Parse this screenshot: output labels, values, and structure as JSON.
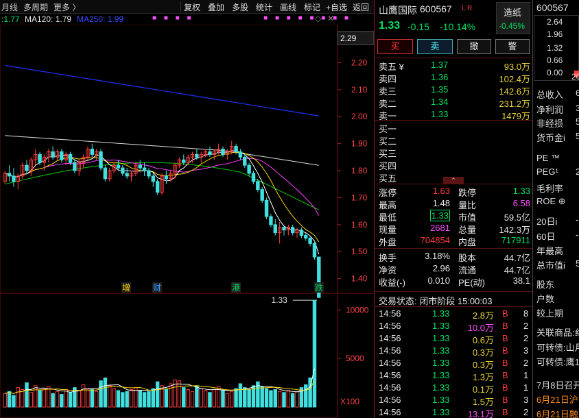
{
  "toolbar": {
    "left": [
      "月线",
      "多周期",
      "更多 〉"
    ],
    "right": [
      "复权",
      "叠加",
      "多股",
      "统计",
      "画线",
      "标记",
      "+自选",
      "返回"
    ]
  },
  "legend": {
    "ma60": ":1.77",
    "ma120": "MA120: 1.79",
    "ma250": "MA250: 1.99",
    "top_price": "2.29"
  },
  "chart_data": {
    "type": "candlestick",
    "price_ticks": [
      "2.20",
      "2.10",
      "2.00",
      "1.90",
      "1.80",
      "1.70",
      "1.60",
      "1.50",
      "1.40"
    ],
    "volume_ticks": [
      "10000",
      "5000"
    ],
    "volume_unit": "X100",
    "low_label": "1.33",
    "markers": [
      {
        "text": "增",
        "color": "#ffd700"
      },
      {
        "text": "财",
        "color": "#3399ff"
      },
      {
        "text": "港",
        "color": "#00e060"
      },
      {
        "text": "跌",
        "color": "#00e060"
      }
    ],
    "colors": {
      "up": "#ff3b3b",
      "down": "#40e0e0",
      "ma5": "#ffffff",
      "ma10": "#ffd700",
      "ma20": "#ff40ff",
      "ma60": "#00cc00",
      "ma120": "#dddddd",
      "ma250": "#2030ff"
    },
    "candles": [
      {
        "o": 1.76,
        "h": 1.8,
        "l": 1.75,
        "c": 1.79
      },
      {
        "o": 1.79,
        "h": 1.82,
        "l": 1.76,
        "c": 1.78
      },
      {
        "o": 1.78,
        "h": 1.81,
        "l": 1.74,
        "c": 1.76
      },
      {
        "o": 1.76,
        "h": 1.79,
        "l": 1.73,
        "c": 1.78
      },
      {
        "o": 1.78,
        "h": 1.83,
        "l": 1.77,
        "c": 1.82
      },
      {
        "o": 1.82,
        "h": 1.84,
        "l": 1.79,
        "c": 1.8
      },
      {
        "o": 1.8,
        "h": 1.85,
        "l": 1.78,
        "c": 1.84
      },
      {
        "o": 1.84,
        "h": 1.88,
        "l": 1.82,
        "c": 1.86
      },
      {
        "o": 1.86,
        "h": 1.87,
        "l": 1.82,
        "c": 1.83
      },
      {
        "o": 1.83,
        "h": 1.86,
        "l": 1.8,
        "c": 1.85
      },
      {
        "o": 1.85,
        "h": 1.88,
        "l": 1.83,
        "c": 1.87
      },
      {
        "o": 1.87,
        "h": 1.89,
        "l": 1.84,
        "c": 1.85
      },
      {
        "o": 1.85,
        "h": 1.88,
        "l": 1.84,
        "c": 1.87
      },
      {
        "o": 1.87,
        "h": 1.88,
        "l": 1.83,
        "c": 1.84
      },
      {
        "o": 1.84,
        "h": 1.87,
        "l": 1.82,
        "c": 1.86
      },
      {
        "o": 1.86,
        "h": 1.87,
        "l": 1.82,
        "c": 1.83
      },
      {
        "o": 1.83,
        "h": 1.84,
        "l": 1.79,
        "c": 1.8
      },
      {
        "o": 1.8,
        "h": 1.84,
        "l": 1.78,
        "c": 1.83
      },
      {
        "o": 1.83,
        "h": 1.86,
        "l": 1.81,
        "c": 1.85
      },
      {
        "o": 1.85,
        "h": 1.89,
        "l": 1.84,
        "c": 1.88
      },
      {
        "o": 1.88,
        "h": 1.9,
        "l": 1.85,
        "c": 1.86
      },
      {
        "o": 1.86,
        "h": 1.88,
        "l": 1.84,
        "c": 1.87
      },
      {
        "o": 1.87,
        "h": 1.88,
        "l": 1.8,
        "c": 1.81
      },
      {
        "o": 1.81,
        "h": 1.82,
        "l": 1.76,
        "c": 1.77
      },
      {
        "o": 1.77,
        "h": 1.81,
        "l": 1.76,
        "c": 1.8
      },
      {
        "o": 1.8,
        "h": 1.83,
        "l": 1.79,
        "c": 1.82
      },
      {
        "o": 1.82,
        "h": 1.84,
        "l": 1.8,
        "c": 1.81
      },
      {
        "o": 1.81,
        "h": 1.82,
        "l": 1.78,
        "c": 1.79
      },
      {
        "o": 1.79,
        "h": 1.81,
        "l": 1.77,
        "c": 1.78
      },
      {
        "o": 1.78,
        "h": 1.8,
        "l": 1.76,
        "c": 1.79
      },
      {
        "o": 1.79,
        "h": 1.83,
        "l": 1.78,
        "c": 1.82
      },
      {
        "o": 1.82,
        "h": 1.84,
        "l": 1.8,
        "c": 1.81
      },
      {
        "o": 1.81,
        "h": 1.83,
        "l": 1.78,
        "c": 1.8
      },
      {
        "o": 1.8,
        "h": 1.81,
        "l": 1.77,
        "c": 1.78
      },
      {
        "o": 1.78,
        "h": 1.79,
        "l": 1.74,
        "c": 1.76
      },
      {
        "o": 1.76,
        "h": 1.77,
        "l": 1.71,
        "c": 1.72
      },
      {
        "o": 1.72,
        "h": 1.79,
        "l": 1.71,
        "c": 1.78
      },
      {
        "o": 1.78,
        "h": 1.8,
        "l": 1.75,
        "c": 1.77
      },
      {
        "o": 1.77,
        "h": 1.8,
        "l": 1.76,
        "c": 1.79
      },
      {
        "o": 1.79,
        "h": 1.83,
        "l": 1.77,
        "c": 1.82
      },
      {
        "o": 1.82,
        "h": 1.85,
        "l": 1.81,
        "c": 1.84
      },
      {
        "o": 1.84,
        "h": 1.86,
        "l": 1.82,
        "c": 1.83
      },
      {
        "o": 1.83,
        "h": 1.86,
        "l": 1.82,
        "c": 1.85
      },
      {
        "o": 1.85,
        "h": 1.87,
        "l": 1.83,
        "c": 1.86
      },
      {
        "o": 1.86,
        "h": 1.88,
        "l": 1.84,
        "c": 1.85
      },
      {
        "o": 1.85,
        "h": 1.87,
        "l": 1.83,
        "c": 1.86
      },
      {
        "o": 1.86,
        "h": 1.88,
        "l": 1.85,
        "c": 1.87
      },
      {
        "o": 1.87,
        "h": 1.89,
        "l": 1.85,
        "c": 1.86
      },
      {
        "o": 1.86,
        "h": 1.88,
        "l": 1.84,
        "c": 1.87
      },
      {
        "o": 1.87,
        "h": 1.9,
        "l": 1.86,
        "c": 1.88
      },
      {
        "o": 1.88,
        "h": 1.89,
        "l": 1.85,
        "c": 1.86
      },
      {
        "o": 1.86,
        "h": 1.88,
        "l": 1.84,
        "c": 1.87
      },
      {
        "o": 1.87,
        "h": 1.91,
        "l": 1.86,
        "c": 1.89
      },
      {
        "o": 1.89,
        "h": 1.9,
        "l": 1.86,
        "c": 1.87
      },
      {
        "o": 1.87,
        "h": 1.88,
        "l": 1.84,
        "c": 1.85
      },
      {
        "o": 1.85,
        "h": 1.86,
        "l": 1.81,
        "c": 1.82
      },
      {
        "o": 1.82,
        "h": 1.83,
        "l": 1.78,
        "c": 1.79
      },
      {
        "o": 1.79,
        "h": 1.8,
        "l": 1.75,
        "c": 1.76
      },
      {
        "o": 1.76,
        "h": 1.77,
        "l": 1.72,
        "c": 1.73
      },
      {
        "o": 1.73,
        "h": 1.74,
        "l": 1.68,
        "c": 1.69
      },
      {
        "o": 1.69,
        "h": 1.7,
        "l": 1.62,
        "c": 1.63
      },
      {
        "o": 1.63,
        "h": 1.64,
        "l": 1.59,
        "c": 1.6
      },
      {
        "o": 1.6,
        "h": 1.62,
        "l": 1.56,
        "c": 1.57
      },
      {
        "o": 1.57,
        "h": 1.61,
        "l": 1.53,
        "c": 1.59
      },
      {
        "o": 1.59,
        "h": 1.6,
        "l": 1.56,
        "c": 1.58
      },
      {
        "o": 1.58,
        "h": 1.6,
        "l": 1.56,
        "c": 1.59
      },
      {
        "o": 1.59,
        "h": 1.6,
        "l": 1.56,
        "c": 1.57
      },
      {
        "o": 1.57,
        "h": 1.59,
        "l": 1.55,
        "c": 1.58
      },
      {
        "o": 1.58,
        "h": 1.59,
        "l": 1.55,
        "c": 1.56
      },
      {
        "o": 1.56,
        "h": 1.57,
        "l": 1.54,
        "c": 1.55
      },
      {
        "o": 1.55,
        "h": 1.56,
        "l": 1.52,
        "c": 1.53
      },
      {
        "o": 1.53,
        "h": 1.54,
        "l": 1.47,
        "c": 1.48
      },
      {
        "o": 1.48,
        "h": 1.48,
        "l": 1.33,
        "c": 1.33
      }
    ],
    "volumes": [
      14,
      16,
      12,
      20,
      18,
      25,
      15,
      22,
      17,
      19,
      21,
      14,
      16,
      13,
      18,
      15,
      20,
      17,
      23,
      19,
      18,
      16,
      27,
      30,
      22,
      19,
      17,
      15,
      16,
      18,
      20,
      17,
      15,
      16,
      19,
      26,
      22,
      18,
      24,
      28,
      27,
      20,
      18,
      16,
      22,
      19,
      17,
      15,
      18,
      21,
      17,
      14,
      16,
      19,
      24,
      20,
      18,
      22,
      26,
      21,
      19,
      17,
      18,
      16,
      15,
      17,
      14,
      16,
      20,
      23,
      30,
      110
    ]
  },
  "quote": {
    "name": "山鹰国际",
    "code": "600567",
    "tags": "L R",
    "badge": "造纸",
    "badge_change": "-0.45%",
    "price": "1.33",
    "change": "-0.15",
    "pct": "-10.14%",
    "buttons": [
      "买",
      "卖",
      "撤",
      "警"
    ]
  },
  "asks": [
    {
      "label": "卖五 ¥",
      "price": "1.37",
      "vol": "93.0万"
    },
    {
      "label": "卖四",
      "price": "1.36",
      "vol": "102.4万"
    },
    {
      "label": "卖三",
      "price": "1.35",
      "vol": "142.6万"
    },
    {
      "label": "卖二",
      "price": "1.34",
      "vol": "231.2万"
    },
    {
      "label": "卖一",
      "price": "1.33",
      "vol": "1479万"
    }
  ],
  "bids": [
    "买一",
    "买二",
    "买三",
    "买四",
    "买五"
  ],
  "stats": {
    "zhangting_l": "涨停",
    "zhangting": "1.63",
    "dieting_l": "跌停",
    "dieting": "1.33",
    "zuigao_l": "最高",
    "zuigao": "1.48",
    "liangbi_l": "量比",
    "liangbi": "6.58",
    "zuidi_l": "最低",
    "zuidi": "1.33",
    "shizhi_l": "市值",
    "shizhi": "59.5亿",
    "xianliang_l": "现量",
    "xianliang": "2681",
    "zongliang_l": "总量",
    "zongliang": "142.3万",
    "waipan_l": "外盘",
    "waipan": "704854",
    "neipan_l": "内盘",
    "neipan": "717911",
    "huanshou_l": "换手",
    "huanshou": "3.18%",
    "guben_l": "股本",
    "guben": "44.7亿",
    "jingzi_l": "净资",
    "jingzi": "2.96",
    "liutong_l": "流通",
    "liutong": "44.7亿",
    "shouyi_l": "收益(-)",
    "shouyi": "0.010",
    "pe_l": "PE(动)",
    "pe": "38.1"
  },
  "trade_status": "交易状态: 闭市阶段 15:00:03",
  "ticks": [
    {
      "t": "14:56",
      "p": "1.33",
      "v": "2.8万",
      "s": "B",
      "n": "8"
    },
    {
      "t": "14:56",
      "p": "1.33",
      "v": "10.0万",
      "s": "B",
      "n": "2"
    },
    {
      "t": "14:56",
      "p": "1.33",
      "v": "0.6万",
      "s": "B",
      "n": "2"
    },
    {
      "t": "14:56",
      "p": "1.33",
      "v": "0.3万",
      "s": "B",
      "n": "3"
    },
    {
      "t": "14:56",
      "p": "1.33",
      "v": "0.3万",
      "s": "B",
      "n": "2"
    },
    {
      "t": "14:56",
      "p": "1.33",
      "v": "1.3万",
      "s": "B",
      "n": "1"
    },
    {
      "t": "14:56",
      "p": "1.33",
      "v": "0.1万",
      "s": "B",
      "n": "1"
    },
    {
      "t": "14:56",
      "p": "1.33",
      "v": "1.5万",
      "s": "B",
      "n": "3"
    },
    {
      "t": "14:56",
      "p": "1.33",
      "v": "13.1万",
      "s": "B",
      "n": "2"
    }
  ],
  "side": {
    "code": "600567",
    "mini_ticks": [
      "2.64",
      "1.96",
      "1.32",
      "0.66",
      "0.00"
    ],
    "mini_x": "20",
    "items": [
      {
        "t": "总收入",
        "v": "6"
      },
      {
        "t": "净利润",
        "v": "3"
      },
      {
        "t": "非经损",
        "v": "5"
      },
      {
        "t": "货币金i",
        "v": "5"
      },
      {
        "t": "PE ™",
        "v": ""
      },
      {
        "t": "PEG¹",
        "v": "2"
      },
      {
        "t": "毛利率",
        "v": ""
      },
      {
        "t": "ROE ⊕",
        "v": ""
      },
      {
        "t": "20日i",
        "v": "-"
      },
      {
        "t": "60日",
        "v": "-"
      },
      {
        "t": "年最高",
        "v": ""
      },
      {
        "t": "总市值i",
        "v": "5"
      },
      {
        "t": "股东",
        "v": ""
      },
      {
        "t": "户数",
        "v": ""
      },
      {
        "t": "较上期",
        "v": ""
      },
      {
        "t": "关联商品:纟",
        "v": ""
      },
      {
        "t": "可转债:山月",
        "v": ""
      },
      {
        "t": "可转债:鹰1",
        "v": ""
      },
      {
        "t": "7月8日召开",
        "v": ""
      },
      {
        "t": "6月21日沪",
        "v": ""
      },
      {
        "t": "6月21日融",
        "v": ""
      }
    ]
  }
}
